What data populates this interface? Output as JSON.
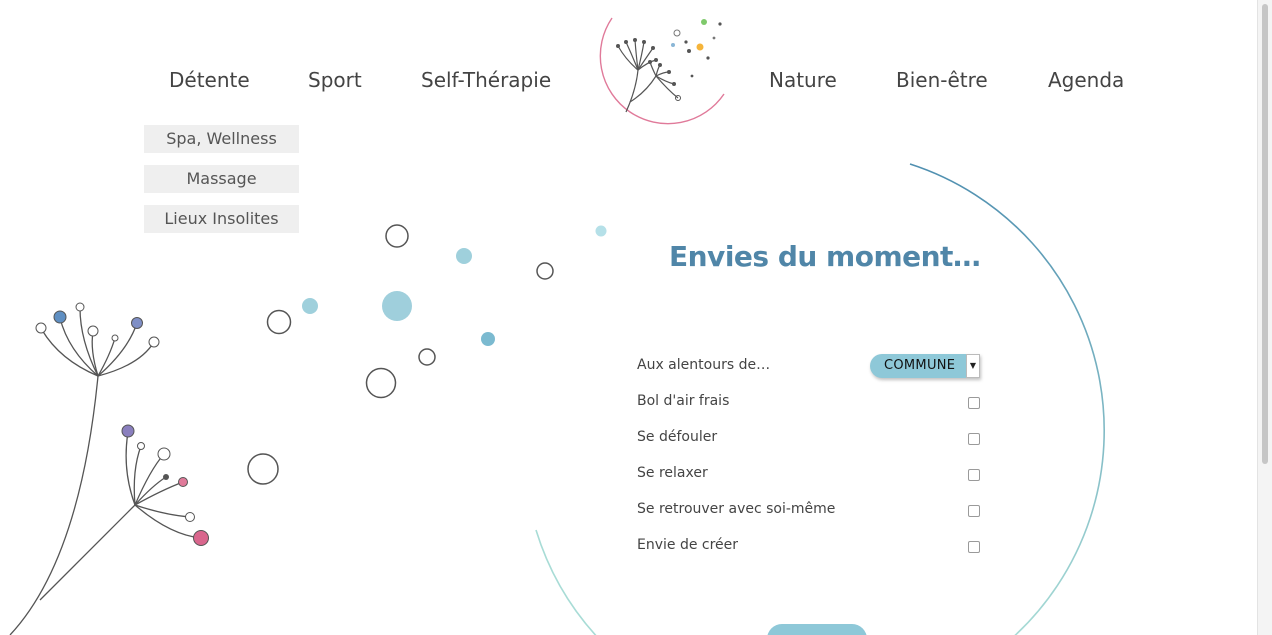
{
  "nav": {
    "left": [
      "Détente",
      "Sport",
      "Self-Thérapie"
    ],
    "right": [
      "Nature",
      "Bien-être",
      "Agenda"
    ]
  },
  "submenu": [
    "Spa, Wellness",
    "Massage",
    "Lieux Insolites"
  ],
  "panel": {
    "title": "Envies du moment…",
    "location_label": "Aux alentours de…",
    "location_value": "COMMUNE",
    "options": [
      {
        "label": "Bol d'air frais",
        "checked": false
      },
      {
        "label": "Se défouler",
        "checked": false
      },
      {
        "label": "Se relaxer",
        "checked": false
      },
      {
        "label": "Se retrouver avec soi-même",
        "checked": false
      },
      {
        "label": "Envie de créer",
        "checked": false
      }
    ]
  },
  "colors": {
    "title": "#5086a8",
    "accent": "#8ec8d8",
    "pink": "#e07a9a",
    "arc_blue": "#4f8fb0",
    "arc_teal": "#a8dcd6"
  },
  "icons": {
    "logo": "dandelion-logo-icon",
    "select_arrow": "caret-down-icon"
  }
}
